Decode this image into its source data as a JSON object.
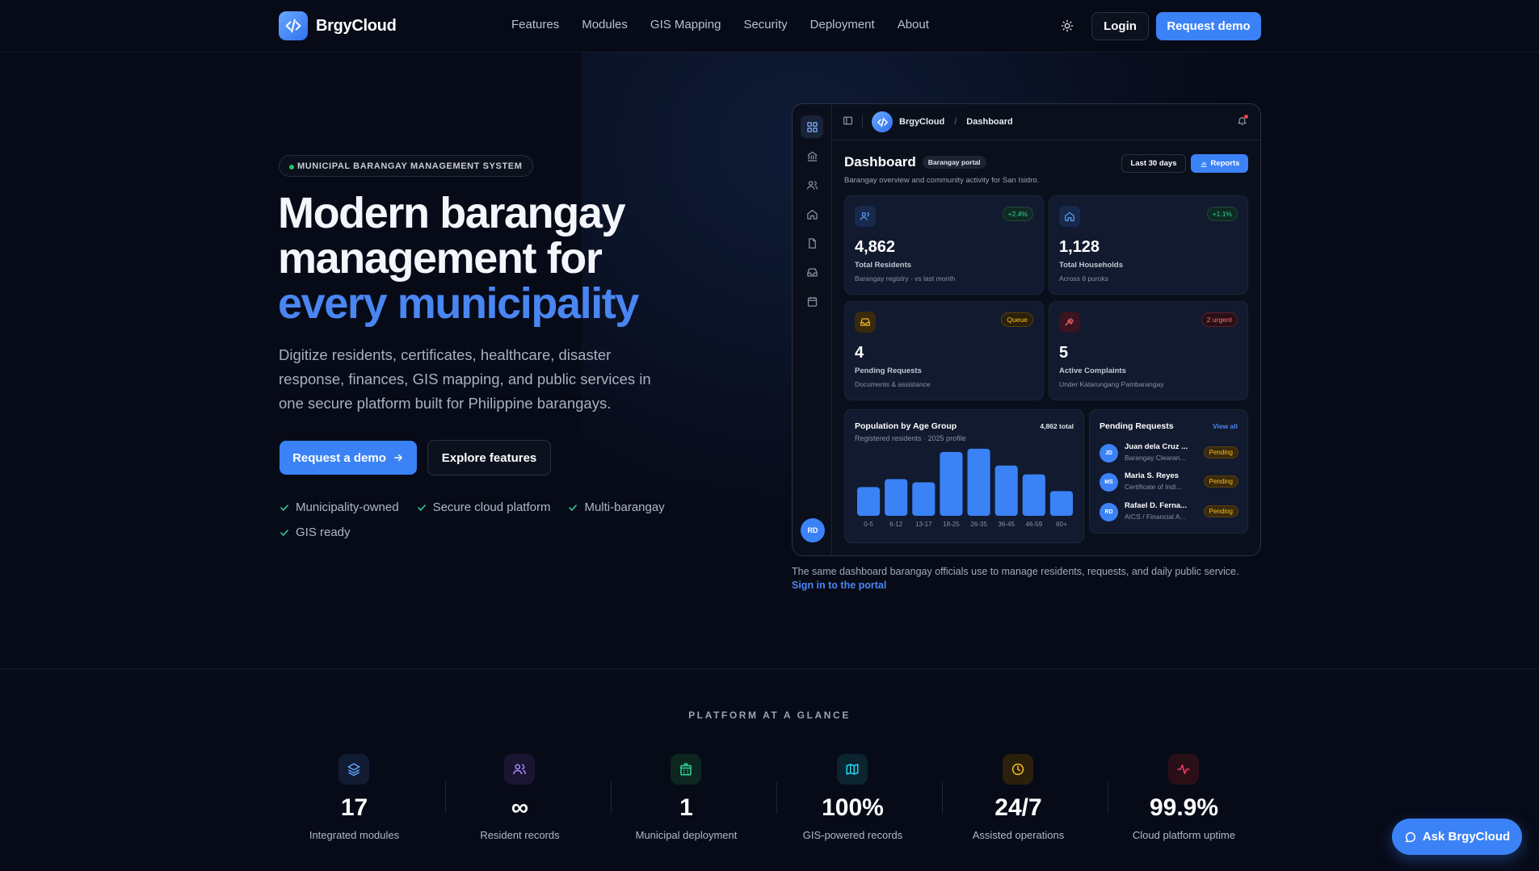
{
  "brand": {
    "name": "BrgyCloud"
  },
  "nav": {
    "links": [
      "Features",
      "Modules",
      "GIS Mapping",
      "Security",
      "Deployment",
      "About"
    ],
    "login": "Login",
    "request_demo": "Request demo"
  },
  "hero": {
    "eyebrow": "MUNICIPAL BARANGAY MANAGEMENT SYSTEM",
    "title_line1": "Modern barangay",
    "title_line2": "management for",
    "title_accent": "every municipality",
    "subtitle": "Digitize residents, certificates, healthcare, disaster response, finances, GIS mapping, and public services in one secure platform built for Philippine barangays.",
    "cta_primary": "Request a demo",
    "cta_secondary": "Explore features",
    "checks": [
      "Municipality-owned",
      "Secure cloud platform",
      "Multi-barangay",
      "GIS ready"
    ]
  },
  "dashboard": {
    "breadcrumb_brand": "BrgyCloud",
    "breadcrumb_page": "Dashboard",
    "title": "Dashboard",
    "pill": "Barangay portal",
    "description": "Barangay overview and community activity for San Isidro.",
    "range": "Last 30 days",
    "reports": "Reports",
    "avatar": "RD",
    "kpis": [
      {
        "value": "4,862",
        "label": "Total Residents",
        "sub": "Barangay registry · vs last month",
        "badge": "+2.4%",
        "color": "#3b82f6"
      },
      {
        "value": "1,128",
        "label": "Total Households",
        "sub": "Across 6 puroks",
        "badge": "+1.1%",
        "color": "#3b82f6"
      },
      {
        "value": "4",
        "label": "Pending Requests",
        "sub": "Documents & assistance",
        "badge": "Queue",
        "color": "#f59e0b"
      },
      {
        "value": "5",
        "label": "Active Complaints",
        "sub": "Under Katarungang Pambarangay",
        "badge": "2 urgent",
        "color": "#ef4444"
      }
    ],
    "population": {
      "title": "Population by Age Group",
      "subtitle": "Registered residents · 2025 profile",
      "total": "4,862 total"
    },
    "pending": {
      "title": "Pending Requests",
      "view_all": "View all",
      "items": [
        {
          "initials": "JD",
          "name": "Juan dela Cruz ...",
          "desc": "Barangay Clearan...",
          "status": "Pending"
        },
        {
          "initials": "MS",
          "name": "Maria S. Reyes",
          "desc": "Certificate of Indi...",
          "status": "Pending"
        },
        {
          "initials": "RD",
          "name": "Rafael D. Ferna...",
          "desc": "AICS / Financial A...",
          "status": "Pending"
        }
      ]
    }
  },
  "chart_data": {
    "type": "bar",
    "title": "Population by Age Group",
    "subtitle": "Registered residents · 2025 profile",
    "categories": [
      "0-5",
      "6-12",
      "13-17",
      "18-25",
      "26-35",
      "36-45",
      "46-59",
      "60+"
    ],
    "values": [
      360,
      460,
      420,
      800,
      840,
      630,
      520,
      310
    ],
    "ylim": [
      0,
      900
    ],
    "grid": false,
    "color": "#3b82f6"
  },
  "caption": {
    "text": "The same dashboard barangay officials use to manage residents, requests, and daily public service.",
    "link": "Sign in to the portal"
  },
  "stats": {
    "heading": "PLATFORM AT A GLANCE",
    "items": [
      {
        "value": "17",
        "label": "Integrated modules",
        "icon": "layers-icon",
        "color": "#60a5fa"
      },
      {
        "value": "∞",
        "label": "Resident records",
        "icon": "users-icon",
        "color": "#a78bfa"
      },
      {
        "value": "1",
        "label": "Municipal deployment",
        "icon": "building-icon",
        "color": "#34d399"
      },
      {
        "value": "100%",
        "label": "GIS-powered records",
        "icon": "map-icon",
        "color": "#22d3ee"
      },
      {
        "value": "24/7",
        "label": "Assisted operations",
        "icon": "clock-icon",
        "color": "#fbbf24"
      },
      {
        "value": "99.9%",
        "label": "Cloud platform uptime",
        "icon": "activity-icon",
        "color": "#f43f5e"
      }
    ]
  },
  "ask": "Ask BrgyCloud"
}
